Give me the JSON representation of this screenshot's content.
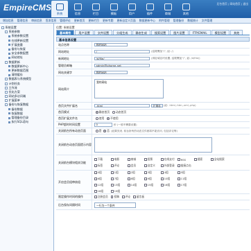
{
  "app": {
    "logo": "EmpireCMS"
  },
  "top_nav": [
    {
      "label": "系统",
      "icon": "system-icon"
    },
    {
      "label": "信息",
      "icon": "info-icon"
    },
    {
      "label": "栏目",
      "icon": "column-icon"
    },
    {
      "label": "模板",
      "icon": "template-icon"
    },
    {
      "label": "用户",
      "icon": "user-icon"
    },
    {
      "label": "插件",
      "icon": "plugin-icon"
    },
    {
      "label": "商城",
      "icon": "shop-icon"
    },
    {
      "label": "其他",
      "icon": "other-icon"
    }
  ],
  "header_links": "后台首页 | 网站首页 | 退出",
  "sub_nav": [
    "增加信息",
    "管理信息",
    "审核信息",
    "签发信息",
    "管理评论",
    "更新首页",
    "更新栏目",
    "更新专题",
    "更新自定义页面",
    "数据更新中心",
    "附件管理",
    "管理备份",
    "数据统计",
    "文件管理",
    "会员管理",
    "备份数据",
    "帮助信息",
    "官方网站",
    "官方论坛",
    "后台地图",
    "系统首页"
  ],
  "sidebar": [
    {
      "label": "系统设置",
      "level": 0,
      "type": "folder"
    },
    {
      "label": "系统参数",
      "level": 1,
      "type": "folder"
    },
    {
      "label": "系统参数设置",
      "level": 2,
      "type": "leaf"
    },
    {
      "label": "在线更新设置",
      "level": 2,
      "type": "leaf"
    },
    {
      "label": "扩展变量",
      "level": 2,
      "type": "leaf"
    },
    {
      "label": "备份与恢复",
      "level": 2,
      "type": "leaf"
    },
    {
      "label": "安全参数配置",
      "level": 2,
      "type": "leaf"
    },
    {
      "label": "网站地址",
      "level": 2,
      "type": "leaf"
    },
    {
      "label": "数据更新",
      "level": 1,
      "type": "folder"
    },
    {
      "label": "数据更新中心",
      "level": 2,
      "type": "leaf"
    },
    {
      "label": "更新数据范围",
      "level": 2,
      "type": "leaf"
    },
    {
      "label": "清除缓存",
      "level": 2,
      "type": "leaf"
    },
    {
      "label": "数据表与系统模型",
      "level": 1,
      "type": "folder"
    },
    {
      "label": "计划任务",
      "level": 1,
      "type": "folder"
    },
    {
      "label": "工作流",
      "level": 1,
      "type": "folder"
    },
    {
      "label": "优化方案",
      "level": 1,
      "type": "folder"
    },
    {
      "label": "网站多访问端",
      "level": 1,
      "type": "folder"
    },
    {
      "label": "扩展菜单",
      "level": 1,
      "type": "folder"
    },
    {
      "label": "备份与恢复数据",
      "level": 1,
      "type": "folder"
    },
    {
      "label": "备份数据",
      "level": 2,
      "type": "leaf"
    },
    {
      "label": "恢复数据",
      "level": 2,
      "type": "leaf"
    },
    {
      "label": "管理备份目录",
      "level": 2,
      "type": "leaf"
    },
    {
      "label": "执行SQL语句",
      "level": 2,
      "type": "leaf"
    }
  ],
  "breadcrumb": "位置: 系统设置",
  "tabs": [
    "基本属性",
    "用户设置",
    "文件设置",
    "分组生成",
    "静态生成",
    "搜索设置",
    "图片设置",
    "FTP/EMAIL",
    "模型设置",
    "其他"
  ],
  "section_title": "基本信息设置",
  "form": {
    "site_name": {
      "label": "站点名称",
      "value": "我的网站"
    },
    "site_url": {
      "label": "网站地址",
      "value": "/",
      "hint": "(结尾需加\"/\", 如: /)"
    },
    "news_url": {
      "label": "新闻地址",
      "value": "/d/file/",
      "hint": "(绑定域名时设置, 结尾需加\"/\", 如: /d/file/)"
    },
    "admin_email": {
      "label": "管理员邮箱",
      "value": "admin@phome.net"
    },
    "keywords": {
      "label": "网站关键字",
      "value": "我的网站"
    },
    "description": {
      "label": "网站简介",
      "value": "我的网站"
    },
    "index_ext": {
      "label": "首页文件扩展名",
      "value": ".html",
      "select": "扩展名",
      "hint": "(如: .html,.htm,.xml,.php)"
    },
    "index_mode": {
      "label": "首页模式",
      "opt1": "静态首页",
      "opt2": "动态首页"
    },
    "index_ext_mode": {
      "label": "首页扩展文件名",
      "opt1": "使用",
      "opt2": "不使用"
    },
    "php_timeout": {
      "label": "PHP超时时间设置",
      "value": "0",
      "hint": "秒 (一般不需要设置)"
    },
    "close_site": {
      "label": "关闭前台所有动态页面",
      "opt1": "是",
      "opt2": "否",
      "hint": "(如果关闭, 前台所有的动态文件都将不能访问, 包括评论等)"
    },
    "close_notice": {
      "label": "关闭前台动态页面提示内容",
      "value": ""
    },
    "close_modules": {
      "label": "关闭前台模块相关功能",
      "items": [
        "下载",
        "电影",
        "商城",
        "投票",
        "在线支付",
        "RSS",
        "搜索",
        "全站搜索",
        "标签",
        "评论",
        "会员",
        "自定义",
        "外部登录",
        "链接点击"
      ]
    },
    "groups": {
      "label": "开启会员组审核组",
      "items": [
        "0组",
        "1组",
        "2组",
        "3组",
        "4组",
        "5组",
        "6组",
        "7组",
        "8组",
        "9组",
        "10组",
        "11组",
        "12组",
        "13组",
        "14组",
        "15组",
        "16组",
        "17组",
        "18组",
        "19组"
      ]
    },
    "audit_mode": {
      "label": "限定操作时间的操作",
      "items": [
        "注册会员",
        "投稿",
        "评论",
        "留言板"
      ]
    },
    "slowdown": {
      "label": "后台保存间隔时间",
      "value": "一行为一个条件"
    }
  }
}
